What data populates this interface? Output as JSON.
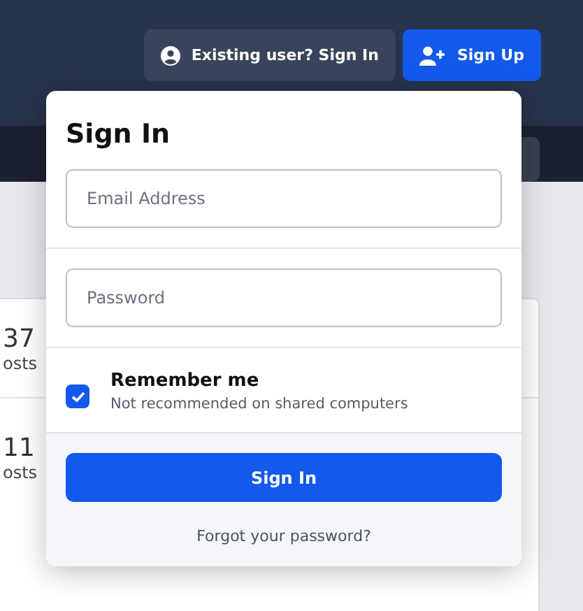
{
  "header": {
    "buttons": [
      {
        "kind": "signin",
        "label": "Existing user? Sign In"
      },
      {
        "kind": "signup",
        "label": "Sign Up"
      }
    ]
  },
  "background_rows": [
    {
      "count": "37",
      "unit": "osts"
    },
    {
      "count": "11",
      "unit": "osts"
    }
  ],
  "popup": {
    "title": "Sign In",
    "fields": [
      {
        "placeholder": "Email Address"
      },
      {
        "placeholder": "Password"
      }
    ],
    "remember": {
      "label": "Remember me",
      "hint": "Not recommended on shared computers",
      "checked": true
    },
    "submit": "Sign In",
    "forgot": "Forgot your password?"
  }
}
